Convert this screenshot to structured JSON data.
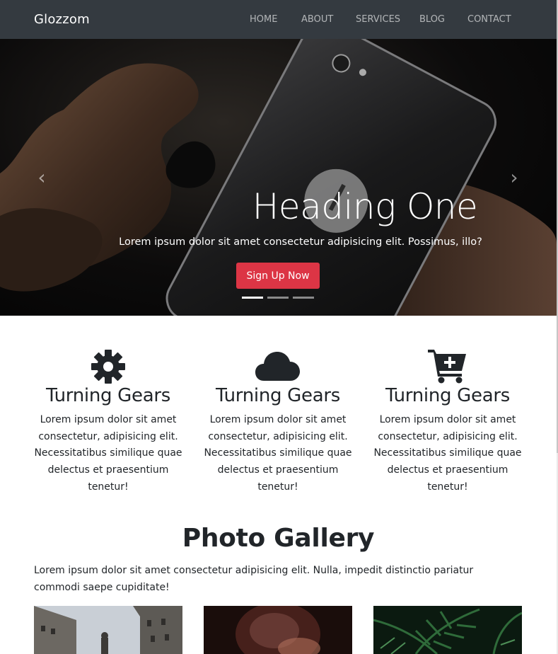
{
  "brand": "Glozzom",
  "nav": {
    "items": [
      {
        "label": "HOME"
      },
      {
        "label": "ABOUT"
      },
      {
        "label": "SERVICES"
      },
      {
        "label": "BLOG"
      },
      {
        "label": "CONTACT"
      }
    ]
  },
  "carousel": {
    "heading": "Heading One",
    "text": "Lorem ipsum dolor sit amet consectetur adipisicing elit. Possimus, illo?",
    "button_label": "Sign Up Now",
    "prev_icon": "chevron-left-icon",
    "next_icon": "chevron-right-icon",
    "slide_count": 3,
    "active_index": 0
  },
  "features": [
    {
      "icon": "gear-icon",
      "title": "Turning Gears",
      "text": "Lorem ipsum dolor sit amet consectetur, adipisicing elit. Necessitatibus similique quae delectus et praesentium tenetur!"
    },
    {
      "icon": "cloud-icon",
      "title": "Turning Gears",
      "text": "Lorem ipsum dolor sit amet consectetur, adipisicing elit. Necessitatibus similique quae delectus et praesentium tenetur!"
    },
    {
      "icon": "cart-plus-icon",
      "title": "Turning Gears",
      "text": "Lorem ipsum dolor sit amet consectetur, adipisicing elit. Necessitatibus similique quae delectus et praesentium tenetur!"
    }
  ],
  "gallery": {
    "title": "Photo Gallery",
    "text": "Lorem ipsum dolor sit amet consectetur adipisicing elit. Nulla, impedit distinctio pariatur commodi saepe cupiditate!"
  },
  "colors": {
    "navbar": "#343a40",
    "accent": "#dc3545",
    "text": "#212529"
  }
}
